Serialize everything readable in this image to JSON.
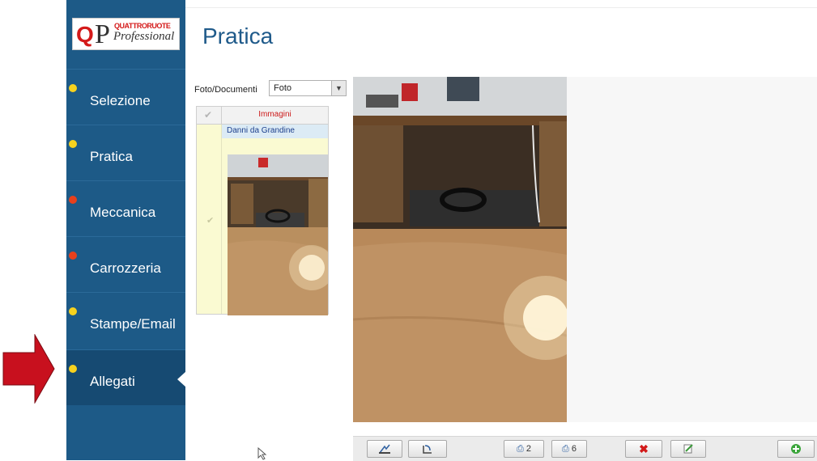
{
  "logo": {
    "letter_q": "Q",
    "letter_p": "P",
    "brand_top": "QUATTRORUOTE",
    "brand_bottom": "Professional"
  },
  "page_title": "Pratica",
  "sidebar": {
    "items": [
      {
        "label": "Selezione",
        "dot_color": "#f7d21e"
      },
      {
        "label": "Pratica",
        "dot_color": "#f7d21e"
      },
      {
        "label": "Meccanica",
        "dot_color": "#e8401c"
      },
      {
        "label": "Carrozzeria",
        "dot_color": "#e8401c"
      },
      {
        "label": "Stampe/Email",
        "dot_color": "#f7d21e"
      },
      {
        "label": "Allegati",
        "dot_color": "#f7d21e",
        "active": true
      }
    ]
  },
  "filter": {
    "label": "Foto/Documenti",
    "value": "Foto"
  },
  "grid": {
    "header": "Immagini",
    "rows": [
      {
        "caption": "Danni da Grandine"
      }
    ]
  },
  "toolbar": {
    "print_count_1": "2",
    "print_count_2": "6"
  },
  "colors": {
    "sidebar": "#1d5a87",
    "title": "#1f5a8a",
    "arrow": "#c8101e",
    "row_highlight": "#fafad2"
  }
}
